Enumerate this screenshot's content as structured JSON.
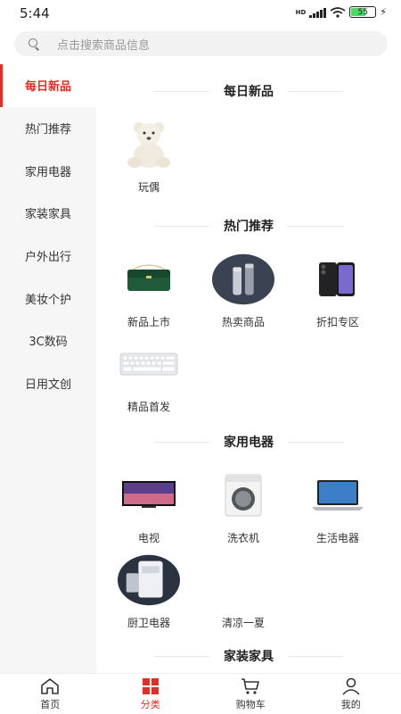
{
  "status_bar": {
    "time": "5:44",
    "battery_level": "55",
    "network": "HD"
  },
  "search": {
    "placeholder": "点击搜索商品信息"
  },
  "sidebar": {
    "items": [
      {
        "label": "每日新品",
        "active": true
      },
      {
        "label": "热门推荐",
        "active": false
      },
      {
        "label": "家用电器",
        "active": false
      },
      {
        "label": "家装家具",
        "active": false
      },
      {
        "label": "户外出行",
        "active": false
      },
      {
        "label": "美妆个护",
        "active": false
      },
      {
        "label": "3C数码",
        "active": false
      },
      {
        "label": "日用文创",
        "active": false
      }
    ]
  },
  "sections": [
    {
      "title": "每日新品",
      "items": [
        {
          "label": "玩偶",
          "icon": "teddy-bear"
        }
      ]
    },
    {
      "title": "热门推荐",
      "items": [
        {
          "label": "新品上市",
          "icon": "green-handbag"
        },
        {
          "label": "热卖商品",
          "icon": "thermos-bottles"
        },
        {
          "label": "折扣专区",
          "icon": "smartphone"
        },
        {
          "label": "精品首发",
          "icon": "keyboard"
        }
      ]
    },
    {
      "title": "家用电器",
      "items": [
        {
          "label": "电视",
          "icon": "television"
        },
        {
          "label": "洗衣机",
          "icon": "washing-machine"
        },
        {
          "label": "生活电器",
          "icon": "laptop"
        },
        {
          "label": "厨卫电器",
          "icon": "water-heater"
        },
        {
          "label": "清凉一夏",
          "icon": ""
        }
      ]
    },
    {
      "title": "家装家具",
      "items": []
    }
  ],
  "bottom_nav": [
    {
      "label": "首页",
      "icon": "home-icon",
      "active": false
    },
    {
      "label": "分类",
      "icon": "category-icon",
      "active": true
    },
    {
      "label": "购物车",
      "icon": "cart-icon",
      "active": false
    },
    {
      "label": "我的",
      "icon": "user-icon",
      "active": false
    }
  ],
  "colors": {
    "accent": "#e02e24",
    "sidebar_bg": "#f6f6f6",
    "search_bg": "#f2f2f2"
  }
}
